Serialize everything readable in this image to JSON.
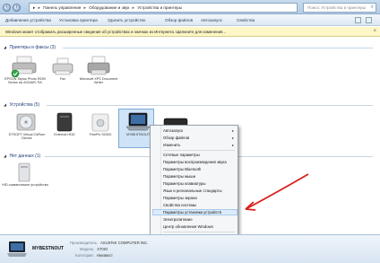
{
  "address_bar": {
    "root_glyph": "▸",
    "crumbs": [
      "Панель управления",
      "Оборудование и звук",
      "Устройства и принтеры"
    ],
    "separator": "▸"
  },
  "search": {
    "placeholder": "Поиск: Устройства и принтеры"
  },
  "toolbar": {
    "add_device": "Добавление устройства",
    "add_printer": "Установка принтера",
    "remove_device": "Удалить устройство",
    "view_files": "Обзор файлов",
    "autoplay": "Автозапуск",
    "properties": "Свойства"
  },
  "infobar": {
    "text": "Windows может отображать расширенные сведения об устройствах и значках из Интернета. Щелкните для изменения...",
    "close": "×"
  },
  "sections": {
    "printers": "Принтеры и факсы (3)",
    "devices": "Устройства (5)",
    "unspecified": "Нет данных (1)"
  },
  "printers": [
    {
      "label": "EPSON Stylus Photo R290 Series на ACMAR-TIK",
      "icon": "printer-default-icon"
    },
    {
      "label": "Fax",
      "icon": "fax-icon"
    },
    {
      "label": "Microsoft XPS Document Writer",
      "icon": "printer-icon"
    }
  ],
  "devices": [
    {
      "label": "DTSOFT Virtual CdRom Device",
      "icon": "cdrom-icon"
    },
    {
      "label": "External HDD",
      "icon": "hdd-icon"
    },
    {
      "label": "FinePix S2000",
      "icon": "camera-icon"
    },
    {
      "label": "MYBESTNOUT",
      "icon": "laptop-icon"
    },
    {
      "label": "",
      "icon": "keyboard-icon"
    }
  ],
  "unspecified": [
    {
      "label": "HID-совместимое устройство",
      "icon": "hid-device-icon"
    }
  ],
  "context_menu": {
    "items": [
      {
        "label": "Автозапуск",
        "submenu": true
      },
      {
        "label": "Обзор файлов",
        "submenu": true
      },
      {
        "label": "Изменить",
        "submenu": true
      },
      {
        "label": "Сетевые параметры",
        "submenu": false
      },
      {
        "label": "Параметры воспроизведения звука",
        "submenu": false
      },
      {
        "label": "Параметры Bluetooth",
        "submenu": false
      },
      {
        "label": "Параметры мыши",
        "submenu": false
      },
      {
        "label": "Параметры клавиатуры",
        "submenu": false
      },
      {
        "label": "Язык и региональные стандарты",
        "submenu": false
      },
      {
        "label": "Параметры экрана",
        "submenu": false
      },
      {
        "label": "Свойства системы",
        "submenu": false
      },
      {
        "label": "Параметры установки устройств",
        "submenu": false
      },
      {
        "label": "Электропитание",
        "submenu": false
      },
      {
        "label": "Центр обновления Windows",
        "submenu": false
      },
      {
        "label": "Создать ярлык",
        "submenu": false
      },
      {
        "label": "Устранение неполадок",
        "submenu": false
      },
      {
        "label": "Свойства",
        "submenu": false
      }
    ],
    "submenu_glyph": "▸"
  },
  "details": {
    "name": "MYBESTNOUT",
    "manufacturer_key": "Производитель:",
    "manufacturer_val": "ASUSTeK COMPUTER INC.",
    "model_key": "Модель:",
    "model_val": "X70IO",
    "category_key": "Категория:",
    "category_val": "Неизвест"
  },
  "colors": {
    "accent": "#1e3f75",
    "highlight_arrow": "#d8201c"
  }
}
